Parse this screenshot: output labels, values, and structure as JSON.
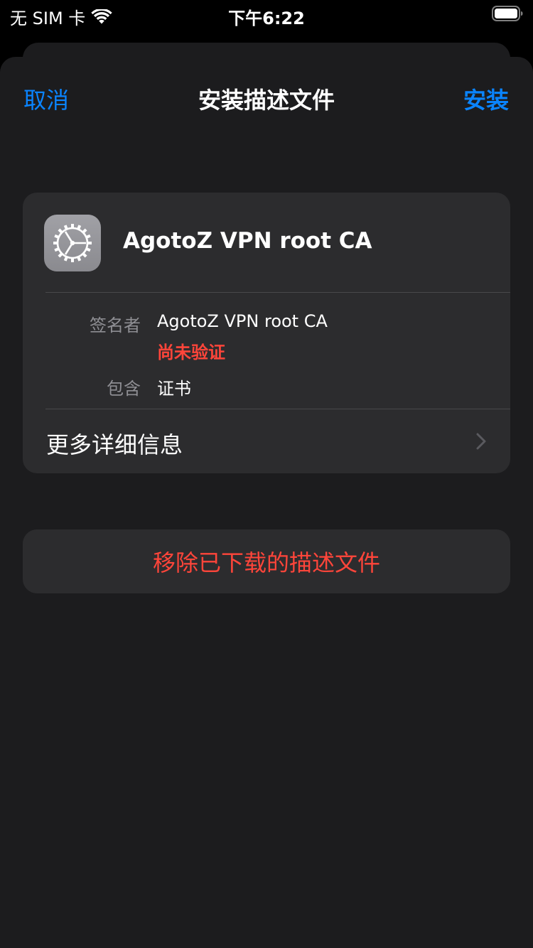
{
  "status_bar": {
    "carrier": "无 SIM 卡",
    "time": "下午6:22",
    "wifi_icon": "wifi-icon",
    "battery_icon": "battery-icon"
  },
  "nav": {
    "cancel_label": "取消",
    "title": "安装描述文件",
    "install_label": "安装"
  },
  "profile": {
    "icon": "settings-gear-icon",
    "name": "AgotoZ VPN root CA",
    "details": {
      "signer_label": "签名者",
      "signer_value": "AgotoZ VPN root CA",
      "verification_status": "尚未验证",
      "contains_label": "包含",
      "contains_value": "证书"
    },
    "more_details_label": "更多详细信息"
  },
  "remove_button": {
    "label": "移除已下载的描述文件"
  },
  "colors": {
    "accent": "#0a84ff",
    "destructive": "#ff453a",
    "sheet_background": "#1c1c1e",
    "card_background": "#2c2c2e",
    "secondary_text": "#8e8e93"
  }
}
